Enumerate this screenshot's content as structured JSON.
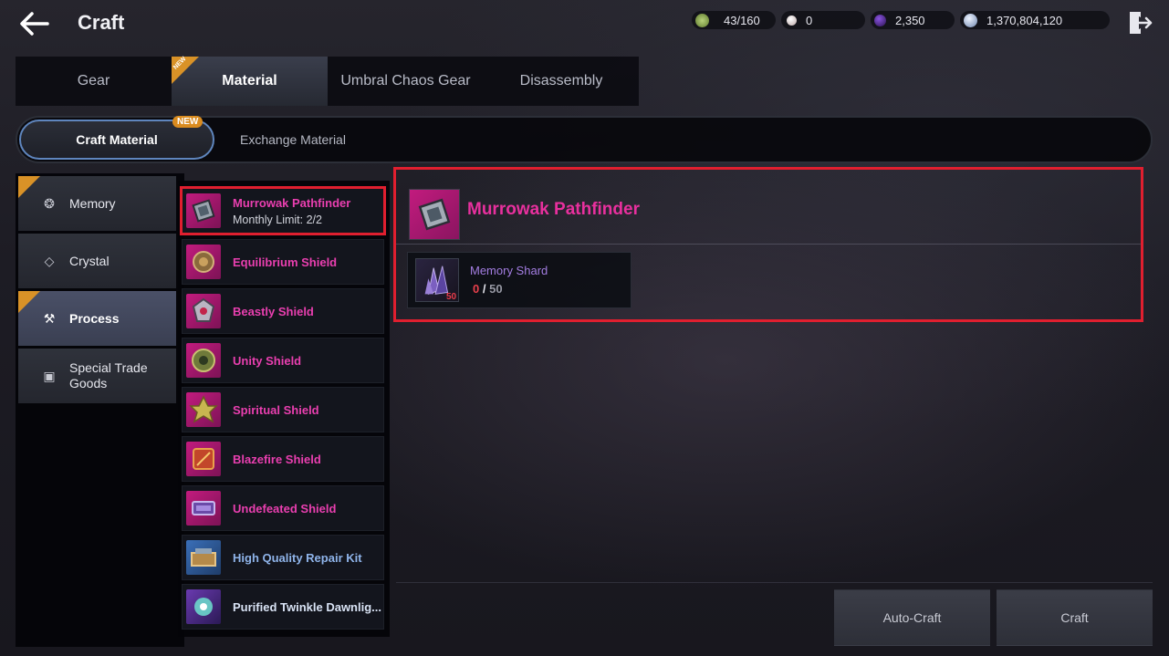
{
  "header": {
    "title": "Craft"
  },
  "currencies": [
    {
      "icon": "spirit-energy-icon",
      "value": "43/160"
    },
    {
      "icon": "pearl-icon",
      "value": "0"
    },
    {
      "icon": "dark-orb-icon",
      "value": "2,350"
    },
    {
      "icon": "silver-coin-icon",
      "value": "1,370,804,120"
    }
  ],
  "main_tabs": [
    {
      "label": "Gear"
    },
    {
      "label": "Material",
      "badge": "NEW"
    },
    {
      "label": "Umbral Chaos Gear"
    },
    {
      "label": "Disassembly"
    }
  ],
  "sub_tabs": [
    {
      "label": "Craft Material",
      "badge": "NEW"
    },
    {
      "label": "Exchange Material"
    }
  ],
  "categories": [
    {
      "label": "Memory",
      "icon": "memory-icon",
      "badge": "NEW"
    },
    {
      "label": "Crystal",
      "icon": "crystal-icon"
    },
    {
      "label": "Process",
      "icon": "hammer-icon",
      "badge": "NEW"
    },
    {
      "label": "Special Trade Goods",
      "icon": "trade-goods-icon"
    }
  ],
  "items": [
    {
      "name": "Murrowak Pathfinder",
      "sub": "Monthly Limit: 2/2"
    },
    {
      "name": "Equilibrium Shield"
    },
    {
      "name": "Beastly Shield"
    },
    {
      "name": "Unity Shield"
    },
    {
      "name": "Spiritual Shield"
    },
    {
      "name": "Blazefire Shield"
    },
    {
      "name": "Undefeated Shield"
    },
    {
      "name": "High Quality Repair Kit"
    },
    {
      "name": "Purified Twinkle Dawnlig..."
    }
  ],
  "detail": {
    "title": "Murrowak Pathfinder",
    "material": {
      "name": "Memory Shard",
      "have": "0",
      "separator": "/",
      "need": "50",
      "badge": "50"
    }
  },
  "buttons": {
    "auto_craft": "Auto-Craft",
    "craft": "Craft"
  },
  "colors": {
    "selected_outline": "#e01f2f",
    "rare_name": "#ea3fb0",
    "blue_name": "#8fb4ea",
    "new_badge": "#d99227"
  }
}
